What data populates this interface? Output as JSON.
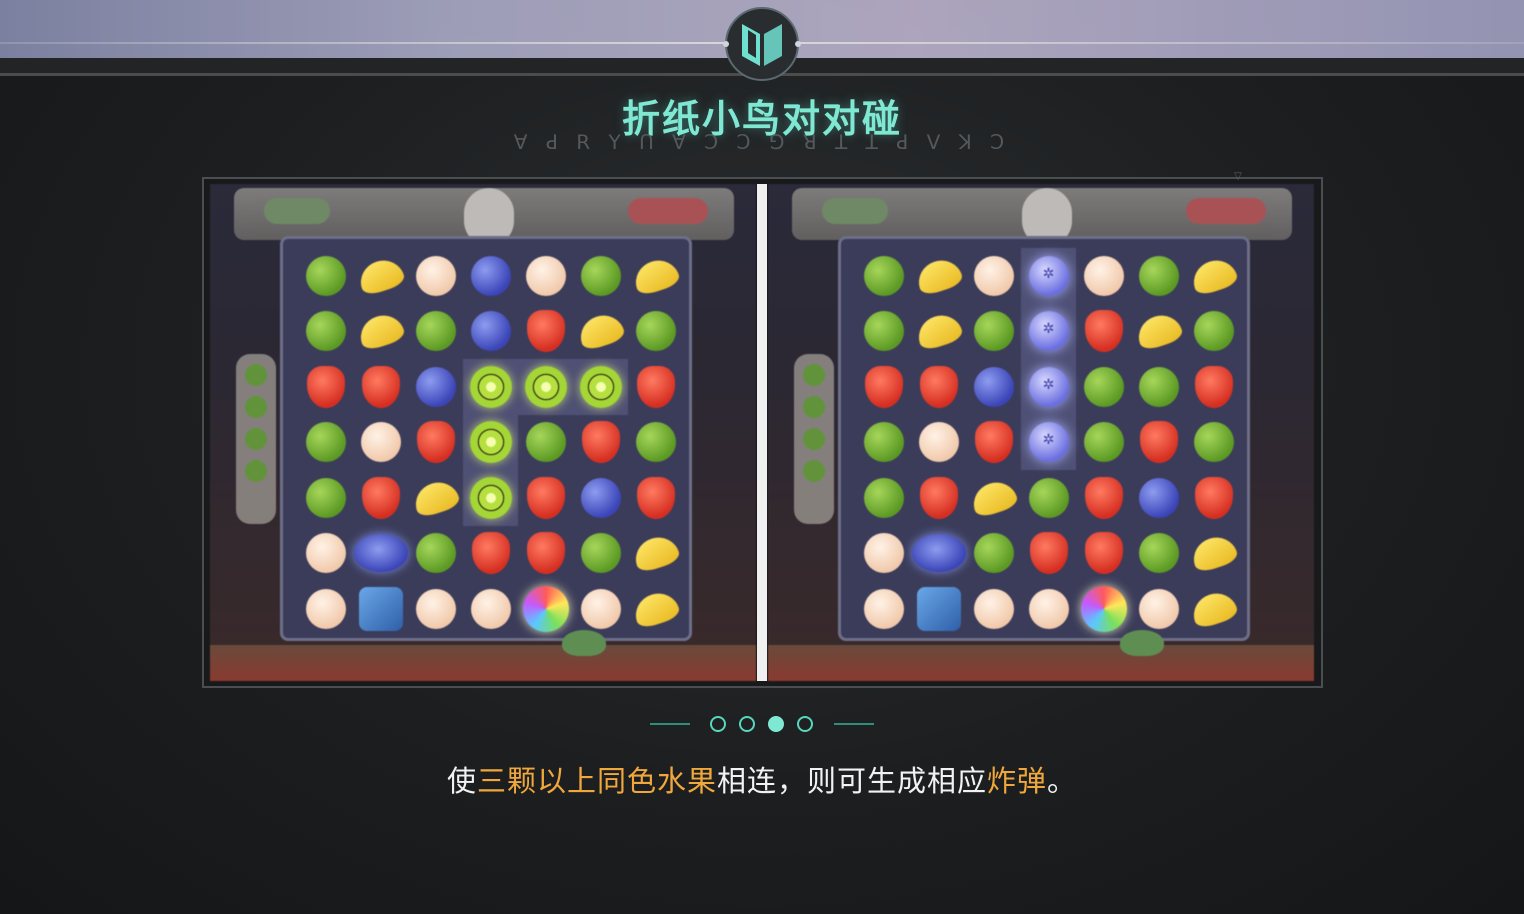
{
  "header": {
    "title": "折纸小鸟对对碰",
    "subtitle_glyphs": "ꓯ ꓒ ꓣ ꓬ ꓵ   ꓯ ꓛ ꓛ ꓨ ꓤ   ꓕ ꓕ ꓒ   ꓦ ꓘ ꓛ"
  },
  "carousel": {
    "page_count": 4,
    "active_page": 3
  },
  "caption": {
    "part1": "使",
    "highlight1": "三颗以上同色水果",
    "part2": "相连，则可生成相应",
    "highlight2": "炸弹",
    "part3": "。"
  },
  "colors": {
    "title": "#7fe8d2",
    "highlight": "#f0a73c",
    "dot": "#5ad6bc"
  },
  "boards": {
    "left": [
      [
        "lime",
        "banana",
        "peach",
        "berry",
        "peach",
        "lime",
        "banana"
      ],
      [
        "lime",
        "banana",
        "lime",
        "berry",
        "straw",
        "banana",
        "lime"
      ],
      [
        "straw",
        "straw",
        "berry",
        "kiwi",
        "kiwi",
        "kiwi",
        "straw"
      ],
      [
        "lime",
        "peach",
        "straw",
        "kiwi",
        "lime",
        "straw",
        "lime"
      ],
      [
        "lime",
        "straw",
        "banana",
        "kiwi",
        "straw",
        "berry",
        "straw"
      ],
      [
        "peach",
        "wide",
        "lime",
        "straw",
        "straw",
        "lime",
        "banana"
      ],
      [
        "peach",
        "ice",
        "peach",
        "peach",
        "rainbow",
        "peach",
        "banana"
      ]
    ],
    "right": [
      [
        "lime",
        "banana",
        "peach",
        "bomb",
        "peach",
        "lime",
        "banana"
      ],
      [
        "lime",
        "banana",
        "lime",
        "bomb",
        "straw",
        "banana",
        "lime"
      ],
      [
        "straw",
        "straw",
        "berry",
        "bomb",
        "lime",
        "lime",
        "straw"
      ],
      [
        "lime",
        "peach",
        "straw",
        "bomb",
        "lime",
        "straw",
        "lime"
      ],
      [
        "lime",
        "straw",
        "banana",
        "lime",
        "straw",
        "berry",
        "straw"
      ],
      [
        "peach",
        "wide",
        "lime",
        "straw",
        "straw",
        "lime",
        "banana"
      ],
      [
        "peach",
        "ice",
        "peach",
        "peach",
        "rainbow",
        "peach",
        "banana"
      ]
    ]
  }
}
